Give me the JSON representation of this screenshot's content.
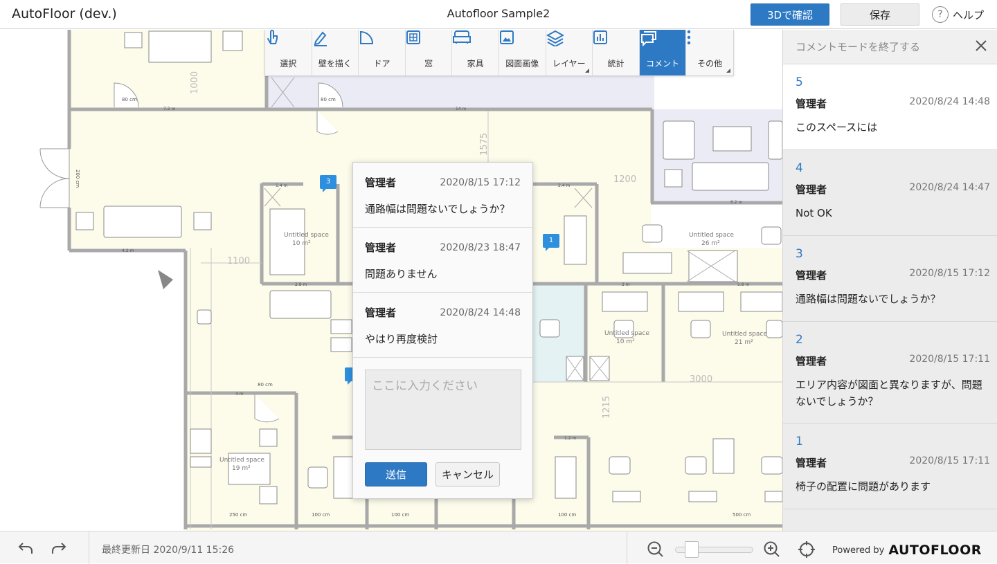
{
  "app_title": "AutoFloor (dev.)",
  "doc_title": "Autofloor Sample2",
  "header": {
    "btn_3d": "3Dで確認",
    "btn_save": "保存",
    "help": "ヘルプ"
  },
  "toolbar": {
    "items": [
      {
        "label": "選択",
        "icon": "pointer-hand-icon"
      },
      {
        "label": "壁を描く",
        "icon": "pencil-icon"
      },
      {
        "label": "ドア",
        "icon": "door-icon"
      },
      {
        "label": "窓",
        "icon": "window-icon"
      },
      {
        "label": "家具",
        "icon": "sofa-icon"
      },
      {
        "label": "図面画像",
        "icon": "image-icon"
      },
      {
        "label": "レイヤー",
        "icon": "layers-icon"
      },
      {
        "label": "統計",
        "icon": "bar-chart-icon"
      },
      {
        "label": "コメント",
        "icon": "comment-icon",
        "active": true
      },
      {
        "label": "その他",
        "icon": "more-vertical-icon"
      }
    ]
  },
  "floorplan": {
    "pins": [
      "3",
      "1"
    ],
    "labels": {
      "door_80_a": "80 cm",
      "door_80_b": "80 cm",
      "door_80_c": "80 cm",
      "wall_7_2": "7.2 m",
      "wall_14": "14 m",
      "wall_4_2": "4.2 m",
      "wall_1_4": "1.4 m",
      "wall_2_4": "2.4 m",
      "wall_2_8": "2.8 m",
      "wall_6_2": "6.2 m",
      "wall_4m": "4 m",
      "wall_250": "250 cm",
      "wall_100a": "100 cm",
      "wall_100b": "100 cm",
      "wall_100c": "100 cm",
      "wall_500": "500 cm",
      "wall_200": "200 cm",
      "wall_1_2": "1.2 m",
      "wall_2m": "2 m",
      "wall_5_8": "5.8 m",
      "dim_1000": "1000",
      "dim_1100": "1100",
      "dim_1575": "1575",
      "dim_1200": "1200",
      "dim_3000": "3000",
      "dim_1215": "1215",
      "space_a": "Untitled space",
      "space_a_area": "26 m²",
      "space_b": "Untitled space",
      "space_b_area": "21 m²",
      "space_c": "Untitled space",
      "space_c_area": "19 m²",
      "space_d": "Untitled space",
      "space_d_area": "10 m²",
      "space_e": "Untitled space",
      "space_e_area": "10 m²"
    }
  },
  "popup": {
    "comments": [
      {
        "author": "管理者",
        "date": "2020/8/15 17:12",
        "text": "通路幅は問題ないでしょうか？"
      },
      {
        "author": "管理者",
        "date": "2020/8/23 18:47",
        "text": "問題ありません"
      },
      {
        "author": "管理者",
        "date": "2020/8/24 14:48",
        "text": "やはり再度検討"
      }
    ],
    "reply_placeholder": "ここに入力ください",
    "send": "送信",
    "cancel": "キャンセル"
  },
  "sidebar": {
    "exit_label": "コメントモードを終了する",
    "comments": [
      {
        "num": "5",
        "author": "管理者",
        "date": "2020/8/24 14:48",
        "text": "このスペースには"
      },
      {
        "num": "4",
        "author": "管理者",
        "date": "2020/8/24 14:47",
        "text": "Not OK"
      },
      {
        "num": "3",
        "author": "管理者",
        "date": "2020/8/15 17:12",
        "text": "通路幅は問題ないでしょうか？"
      },
      {
        "num": "2",
        "author": "管理者",
        "date": "2020/8/15 17:11",
        "text": "エリア内容が図面と異なりますが、問題ないでしょうか？"
      },
      {
        "num": "1",
        "author": "管理者",
        "date": "2020/8/15 17:11",
        "text": "椅子の配置に問題があります"
      }
    ]
  },
  "footer": {
    "last_updated": "最終更新日 2020/9/11 15:26",
    "powered_by": "Powered by",
    "brand": "AUTOFLOOR",
    "zoom_level": 0.15
  },
  "colors": {
    "accent": "#2e79c4",
    "floor": "#fdfbea",
    "wall": "#a9a9a9",
    "blue_room": "#e9e9f5"
  }
}
